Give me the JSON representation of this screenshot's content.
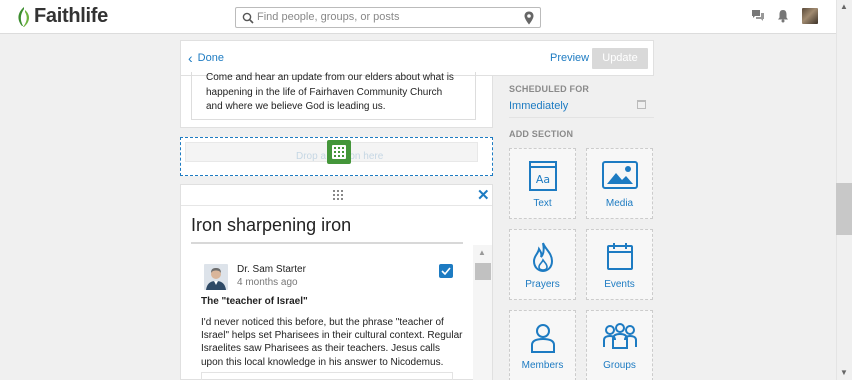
{
  "brand": {
    "name": "Faithlife"
  },
  "search": {
    "placeholder": "Find people, groups, or posts"
  },
  "editor": {
    "done_label": "Done",
    "preview_label": "Preview",
    "update_label": "Update"
  },
  "intro_text": "Come and hear an update from our elders about what is happening in the life of Fairhaven Community Church and where we believe God is leading us.",
  "dropzone": {
    "text": "Drop a section here"
  },
  "post_card": {
    "title": "Iron sharpening iron",
    "author": "Dr. Sam Starter",
    "time": "4 months ago",
    "heading": "The \"teacher of Israel\"",
    "body": "I'd never noticed this before, but the phrase \"teacher of Israel\" helps set Pharisees in their cultural context. Regular Israelites saw Pharisees as their teachers. Jesus calls upon this local knowledge in his answer to Nicodemus.",
    "selected": true
  },
  "sidebar": {
    "scheduled_label": "SCHEDULED FOR",
    "scheduled_value": "Immediately",
    "add_section_label": "ADD SECTION",
    "tiles": [
      {
        "label": "Text",
        "icon": "text-section-icon"
      },
      {
        "label": "Media",
        "icon": "media-image-icon"
      },
      {
        "label": "Prayers",
        "icon": "prayer-flame-icon"
      },
      {
        "label": "Events",
        "icon": "calendar-icon"
      },
      {
        "label": "Members",
        "icon": "member-person-icon"
      },
      {
        "label": "Groups",
        "icon": "groups-people-icon"
      }
    ]
  },
  "colors": {
    "accent": "#1d7bc2",
    "brand_green": "#44963a",
    "update_disabled": "#d9d9d9"
  }
}
